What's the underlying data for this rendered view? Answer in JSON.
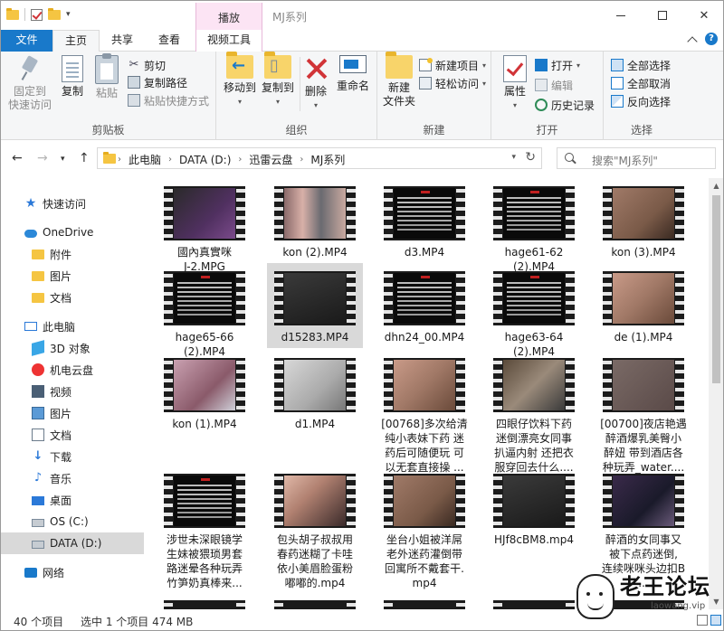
{
  "window": {
    "title": "MJ系列",
    "context_tab": "播放"
  },
  "tabs": [
    "文件",
    "主页",
    "共享",
    "查看",
    "视频工具"
  ],
  "ribbon": {
    "clipboard": {
      "label": "剪贴板",
      "pin": "固定到\n快速访问",
      "copy": "复制",
      "paste": "粘贴",
      "cut": "剪切",
      "copy_path": "复制路径",
      "paste_shortcut": "粘贴快捷方式"
    },
    "organize": {
      "label": "组织",
      "move_to": "移动到",
      "copy_to": "复制到",
      "delete": "删除",
      "rename": "重命名"
    },
    "new": {
      "label": "新建",
      "new_folder": "新建\n文件夹",
      "new_item": "新建项目",
      "easy_access": "轻松访问"
    },
    "open": {
      "label": "打开",
      "properties": "属性",
      "open": "打开",
      "edit": "编辑",
      "history": "历史记录"
    },
    "select": {
      "label": "选择",
      "select_all": "全部选择",
      "select_none": "全部取消",
      "invert": "反向选择"
    }
  },
  "address": {
    "crumbs": [
      "此电脑",
      "DATA (D:)",
      "迅雷云盘",
      "MJ系列"
    ],
    "search_placeholder": "搜索\"MJ系列\""
  },
  "nav": [
    {
      "label": "快速访问",
      "icon": "star-icon"
    },
    {
      "label": "OneDrive",
      "icon": "cloud-icon"
    },
    {
      "label": "附件",
      "icon": "folder-icon"
    },
    {
      "label": "图片",
      "icon": "folder-icon"
    },
    {
      "label": "文档",
      "icon": "folder-icon"
    },
    {
      "label": "此电脑",
      "icon": "computer-icon"
    },
    {
      "label": "3D 对象",
      "icon": "cube-icon"
    },
    {
      "label": "机电云盘",
      "icon": "cloud-drive-icon"
    },
    {
      "label": "视频",
      "icon": "video-icon"
    },
    {
      "label": "图片",
      "icon": "pictures-icon"
    },
    {
      "label": "文档",
      "icon": "documents-icon"
    },
    {
      "label": "下载",
      "icon": "download-icon"
    },
    {
      "label": "音乐",
      "icon": "music-icon"
    },
    {
      "label": "桌面",
      "icon": "desktop-icon"
    },
    {
      "label": "OS (C:)",
      "icon": "drive-icon"
    },
    {
      "label": "DATA (D:)",
      "icon": "drive-icon"
    },
    {
      "label": "网络",
      "icon": "network-icon"
    }
  ],
  "files": [
    {
      "name": "國內真實咪\nJ-2.MPG",
      "thumb": "f-title"
    },
    {
      "name": "kon (2).MP4",
      "thumb": "f-people"
    },
    {
      "name": "d3.MP4",
      "thumb": "f-warn"
    },
    {
      "name": "hage61-62\n(2).MP4",
      "thumb": "f-warn"
    },
    {
      "name": "kon (3).MP4",
      "thumb": "f-skin"
    },
    {
      "name": "hage65-66\n(2).MP4",
      "thumb": "f-warn"
    },
    {
      "name": "d15283.MP4",
      "thumb": "f-dark"
    },
    {
      "name": "dhn24_00.MP4",
      "thumb": "f-warn"
    },
    {
      "name": "hage63-64\n(2).MP4",
      "thumb": "f-warn"
    },
    {
      "name": "de (1).MP4",
      "thumb": "f-skin2"
    },
    {
      "name": "kon (1).MP4",
      "thumb": "f-pink"
    },
    {
      "name": "d1.MP4",
      "thumb": "f-white"
    },
    {
      "name": "[00768]多次给清\n纯小表妹下药 迷\n药后可随便玩 可\n以无套直接操 ...",
      "thumb": "f-skin2"
    },
    {
      "name": "四眼仔饮料下药\n迷倒漂亮女同事\n扒逼内射 还把衣\n服穿回去什么....",
      "thumb": "f-room"
    },
    {
      "name": "[00700]夜店艳遇\n醉酒爆乳美臀小\n醉妞 带到酒店各\n种玩弄_water....",
      "thumb": "f-bed"
    },
    {
      "name": "涉世未深眼镜学\n生妹被猥琐男套\n路迷晕各种玩弄\n竹笋奶真棒来...",
      "thumb": "f-warn"
    },
    {
      "name": "包头胡子叔叔用\n春药迷糊了卡哇\n依小美眉脸蛋粉\n嘟嘟的.mp4",
      "thumb": "f-face"
    },
    {
      "name": "坐台小姐被洋屌\n老外迷药灌倒带\n回寓所不戴套干.\nmp4",
      "thumb": "f-skin"
    },
    {
      "name": "HJf8cBM8.mp4",
      "thumb": "f-dark"
    },
    {
      "name": "醉酒的女同事又\n被下点药迷倒,\n连续咪咪头边扣B\n...",
      "thumb": "f-night"
    }
  ],
  "status": {
    "count": "40 个项目",
    "selected": "选中 1 个项目  474 MB"
  },
  "watermark": {
    "text": "老王论坛",
    "url": "laowang.vip"
  }
}
